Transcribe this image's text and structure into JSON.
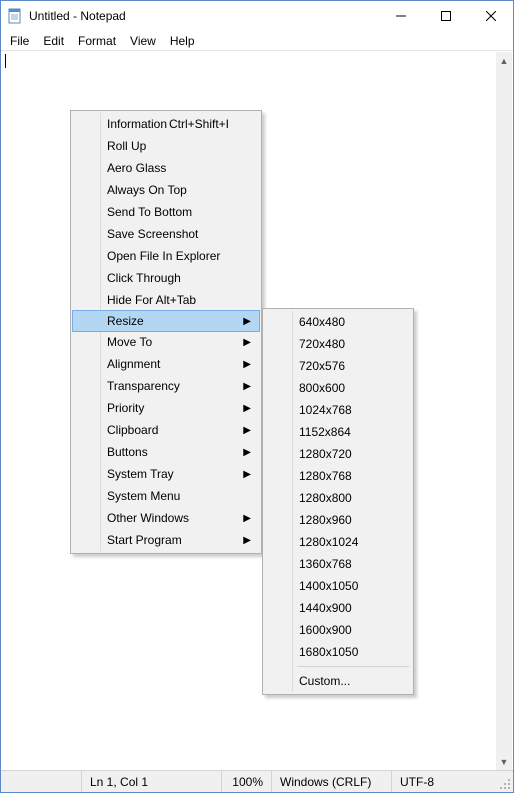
{
  "titlebar": {
    "title": "Untitled - Notepad"
  },
  "menubar": [
    "File",
    "Edit",
    "Format",
    "View",
    "Help"
  ],
  "status": {
    "lncol": "Ln 1, Col 1",
    "zoom": "100%",
    "eol": "Windows (CRLF)",
    "encoding": "UTF-8"
  },
  "context_menu": {
    "items": [
      {
        "label": "Information",
        "shortcut": "Ctrl+Shift+I",
        "submenu": false
      },
      {
        "label": "Roll Up",
        "submenu": false
      },
      {
        "label": "Aero Glass",
        "submenu": false
      },
      {
        "label": "Always On Top",
        "submenu": false
      },
      {
        "label": "Send To Bottom",
        "submenu": false
      },
      {
        "label": "Save Screenshot",
        "submenu": false
      },
      {
        "label": "Open File In Explorer",
        "submenu": false
      },
      {
        "label": "Click Through",
        "submenu": false
      },
      {
        "label": "Hide For Alt+Tab",
        "submenu": false
      },
      {
        "label": "Resize",
        "submenu": true,
        "highlight": true
      },
      {
        "label": "Move To",
        "submenu": true
      },
      {
        "label": "Alignment",
        "submenu": true
      },
      {
        "label": "Transparency",
        "submenu": true
      },
      {
        "label": "Priority",
        "submenu": true
      },
      {
        "label": "Clipboard",
        "submenu": true
      },
      {
        "label": "Buttons",
        "submenu": true
      },
      {
        "label": "System Tray",
        "submenu": true
      },
      {
        "label": "System Menu",
        "submenu": false
      },
      {
        "label": "Other Windows",
        "submenu": true
      },
      {
        "label": "Start Program",
        "submenu": true
      }
    ]
  },
  "resize_submenu": {
    "items": [
      "640x480",
      "720x480",
      "720x576",
      "800x600",
      "1024x768",
      "1152x864",
      "1280x720",
      "1280x768",
      "1280x800",
      "1280x960",
      "1280x1024",
      "1360x768",
      "1400x1050",
      "1440x900",
      "1600x900",
      "1680x1050"
    ],
    "custom": "Custom..."
  }
}
